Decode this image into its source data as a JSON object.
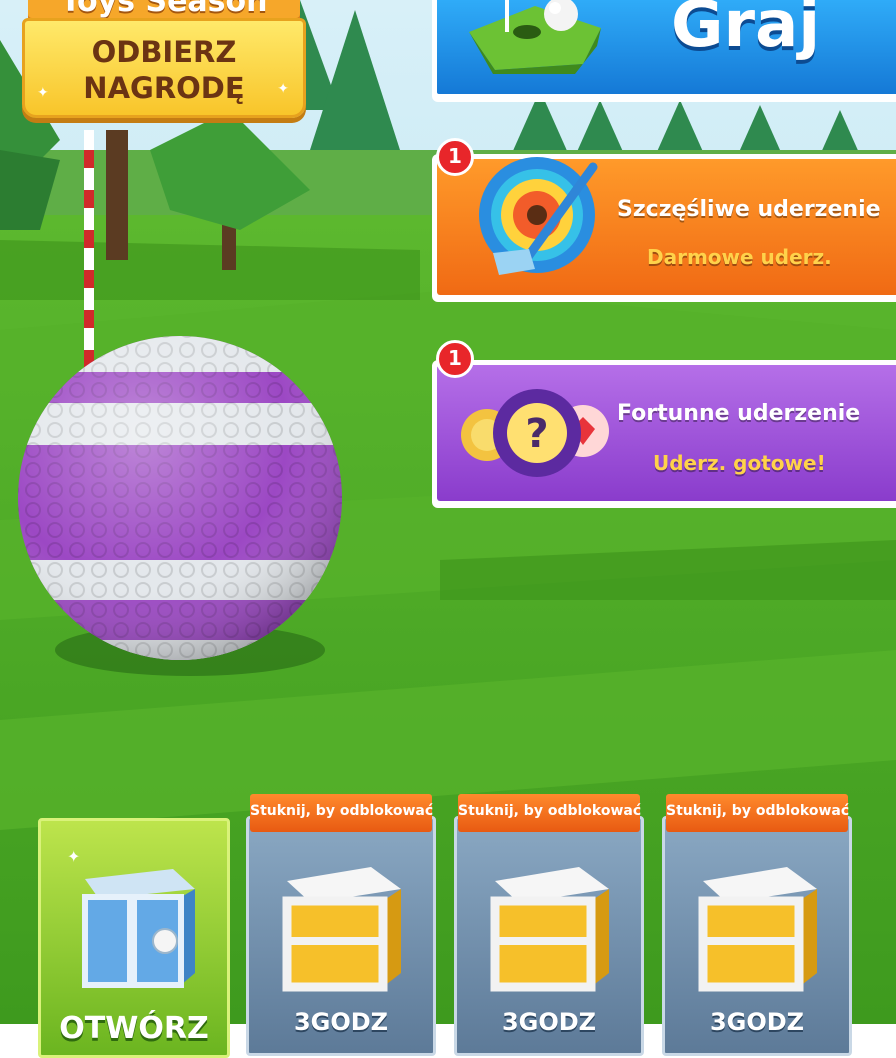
{
  "season_banner": {
    "title": "Toys Season",
    "claim_line1": "ODBIERZ",
    "claim_line2": "NAGRODĘ"
  },
  "play_button": {
    "label": "Graj",
    "icon": "golf-hole-icon"
  },
  "events": [
    {
      "title": "Szczęśliwe uderzenie",
      "subtitle": "Darmowe uderz.",
      "badge": "1",
      "icon": "target-club-icon",
      "color": "#f57b1f"
    },
    {
      "title": "Fortunne uderzenie",
      "subtitle": "Uderz. gotowe!",
      "badge": "1",
      "icon": "mystery-ball-icon",
      "color": "#9b4fd8"
    }
  ],
  "chest_slots": [
    {
      "state": "open",
      "label": "OTWÓRZ",
      "icon": "silver-chest-icon"
    },
    {
      "state": "locked",
      "ribbon": "Stuknij, by odblokować",
      "time": "3GODZ",
      "icon": "gold-chest-icon"
    },
    {
      "state": "locked",
      "ribbon": "Stuknij, by odblokować",
      "time": "3GODZ",
      "icon": "gold-chest-icon"
    },
    {
      "state": "locked",
      "ribbon": "Stuknij, by odblokować",
      "time": "3GODZ",
      "icon": "gold-chest-icon"
    }
  ],
  "colors": {
    "grass": "#47a623",
    "sky": "#bfe6f3",
    "ball_purple": "#9c48c4",
    "ball_white": "#e4e8ec"
  }
}
